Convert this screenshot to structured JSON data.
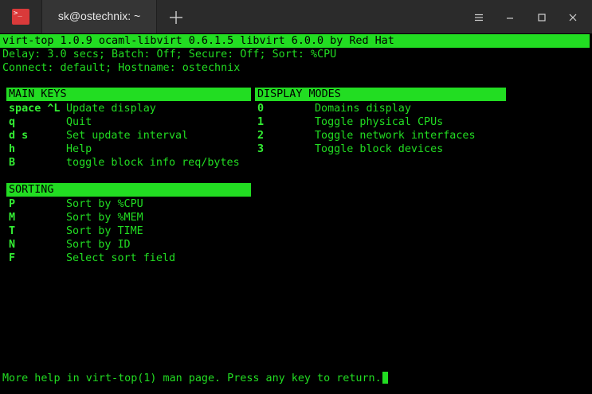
{
  "titlebar": {
    "tab_title": "sk@ostechnix: ~",
    "app_icon_glyph_1": ">_",
    "icons": {
      "app": "terminal-icon",
      "new_tab": "plus-icon",
      "menu": "hamburger-menu-icon",
      "minimize": "minimize-icon",
      "maximize": "maximize-icon",
      "close": "close-icon"
    }
  },
  "colors": {
    "terminal_bg": "#000000",
    "terminal_fg": "#22dd22",
    "highlight_bg": "#22dd22",
    "titlebar_bg": "#2b2b2b",
    "app_icon_bg": "#d93a3a"
  },
  "terminal": {
    "header": "virt-top 1.0.9 ocaml-libvirt 0.6.1.5 libvirt 6.0.0 by Red Hat",
    "status_line_1": "Delay: 3.0 secs; Batch: Off; Secure: Off; Sort: %CPU",
    "status_line_2": "Connect: default; Hostname: ostechnix",
    "main_keys": {
      "title": "MAIN KEYS",
      "items": [
        {
          "key": "space ^L",
          "desc": "Update display"
        },
        {
          "key": "q",
          "desc": "Quit"
        },
        {
          "key": "d s",
          "desc": "Set update interval"
        },
        {
          "key": "h",
          "desc": "Help"
        },
        {
          "key": "B",
          "desc": "toggle block info req/bytes"
        }
      ]
    },
    "display_modes": {
      "title": "DISPLAY MODES",
      "items": [
        {
          "key": "0",
          "desc": "Domains display"
        },
        {
          "key": "1",
          "desc": "Toggle physical CPUs"
        },
        {
          "key": "2",
          "desc": "Toggle network interfaces"
        },
        {
          "key": "3",
          "desc": "Toggle block devices"
        }
      ]
    },
    "sorting": {
      "title": "SORTING",
      "items": [
        {
          "key": "P",
          "desc": "Sort by %CPU"
        },
        {
          "key": "M",
          "desc": "Sort by %MEM"
        },
        {
          "key": "T",
          "desc": "Sort by TIME"
        },
        {
          "key": "N",
          "desc": "Sort by ID"
        },
        {
          "key": "F",
          "desc": "Select sort field"
        }
      ]
    },
    "footer": "More help in virt-top(1) man page. Press any key to return."
  }
}
